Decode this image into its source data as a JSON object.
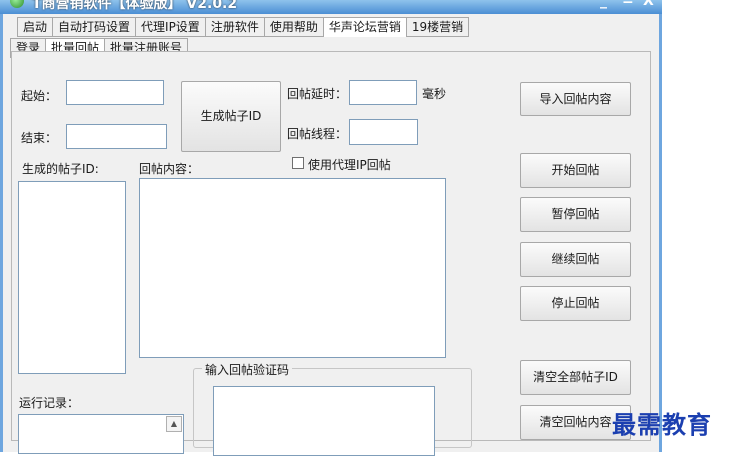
{
  "window": {
    "title": "T商营销软件【体验版】 V2.0.2",
    "controls": {
      "minimize": "_",
      "maximize": "=",
      "close": "X"
    }
  },
  "main_tabs": [
    "启动",
    "自动打码设置",
    "代理IP设置",
    "注册软件",
    "使用帮助",
    "华声论坛营销",
    "19楼营销"
  ],
  "sub_tabs": [
    "登录",
    "批量回帖",
    "批量注册账号"
  ],
  "form": {
    "start_label": "起始：",
    "end_label": "结束：",
    "generate_button": "生成帖子ID",
    "delay_label": "回帖延时：",
    "delay_unit": "毫秒",
    "threads_label": "回帖线程：",
    "use_proxy_label": "使用代理IP回帖",
    "generated_ids_label": "生成的帖子ID:",
    "reply_content_label": "回帖内容：",
    "captcha_group_label": "输入回帖验证码",
    "log_label": "运行记录："
  },
  "buttons": {
    "import": "导入回帖内容",
    "start": "开始回帖",
    "pause": "暂停回帖",
    "resume": "继续回帖",
    "stop": "停止回帖",
    "clear_ids": "清空全部帖子ID",
    "clear_content": "清空回帖内容"
  },
  "watermark": "最需教育"
}
